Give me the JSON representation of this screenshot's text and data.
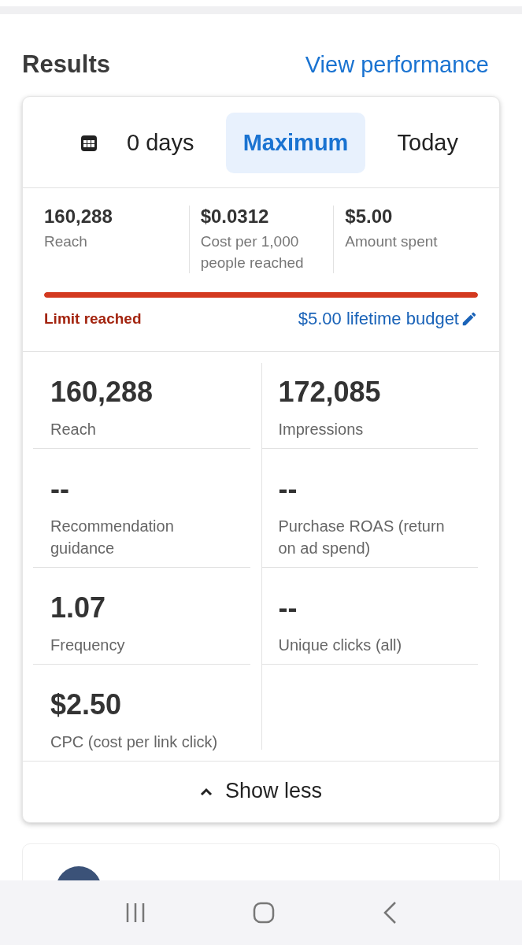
{
  "header": {
    "title": "Results",
    "link": "View performance"
  },
  "tabs": [
    {
      "label": "0 days",
      "kind": "calendar",
      "selected": false
    },
    {
      "label": "Maximum",
      "kind": "text",
      "selected": true
    },
    {
      "label": "Today",
      "kind": "text",
      "selected": false
    }
  ],
  "summary": [
    {
      "value": "160,288",
      "label": "Reach"
    },
    {
      "value": "$0.0312",
      "label": "Cost per 1,000 people reached"
    },
    {
      "value": "$5.00",
      "label": "Amount spent"
    }
  ],
  "budget": {
    "status": "Limit reached",
    "limit": "$5.00 lifetime budget"
  },
  "metrics": [
    {
      "value": "160,288",
      "label": "Reach"
    },
    {
      "value": "172,085",
      "label": "Impressions"
    },
    {
      "value": "--",
      "label": "Recommendation guidance"
    },
    {
      "value": "--",
      "label": "Purchase ROAS (return on ad spend)"
    },
    {
      "value": "1.07",
      "label": "Frequency"
    },
    {
      "value": "--",
      "label": "Unique clicks (all)"
    },
    {
      "value": "$2.50",
      "label": "CPC (cost per link click)"
    }
  ],
  "toggle": {
    "label": "Show less",
    "expanded": true
  }
}
